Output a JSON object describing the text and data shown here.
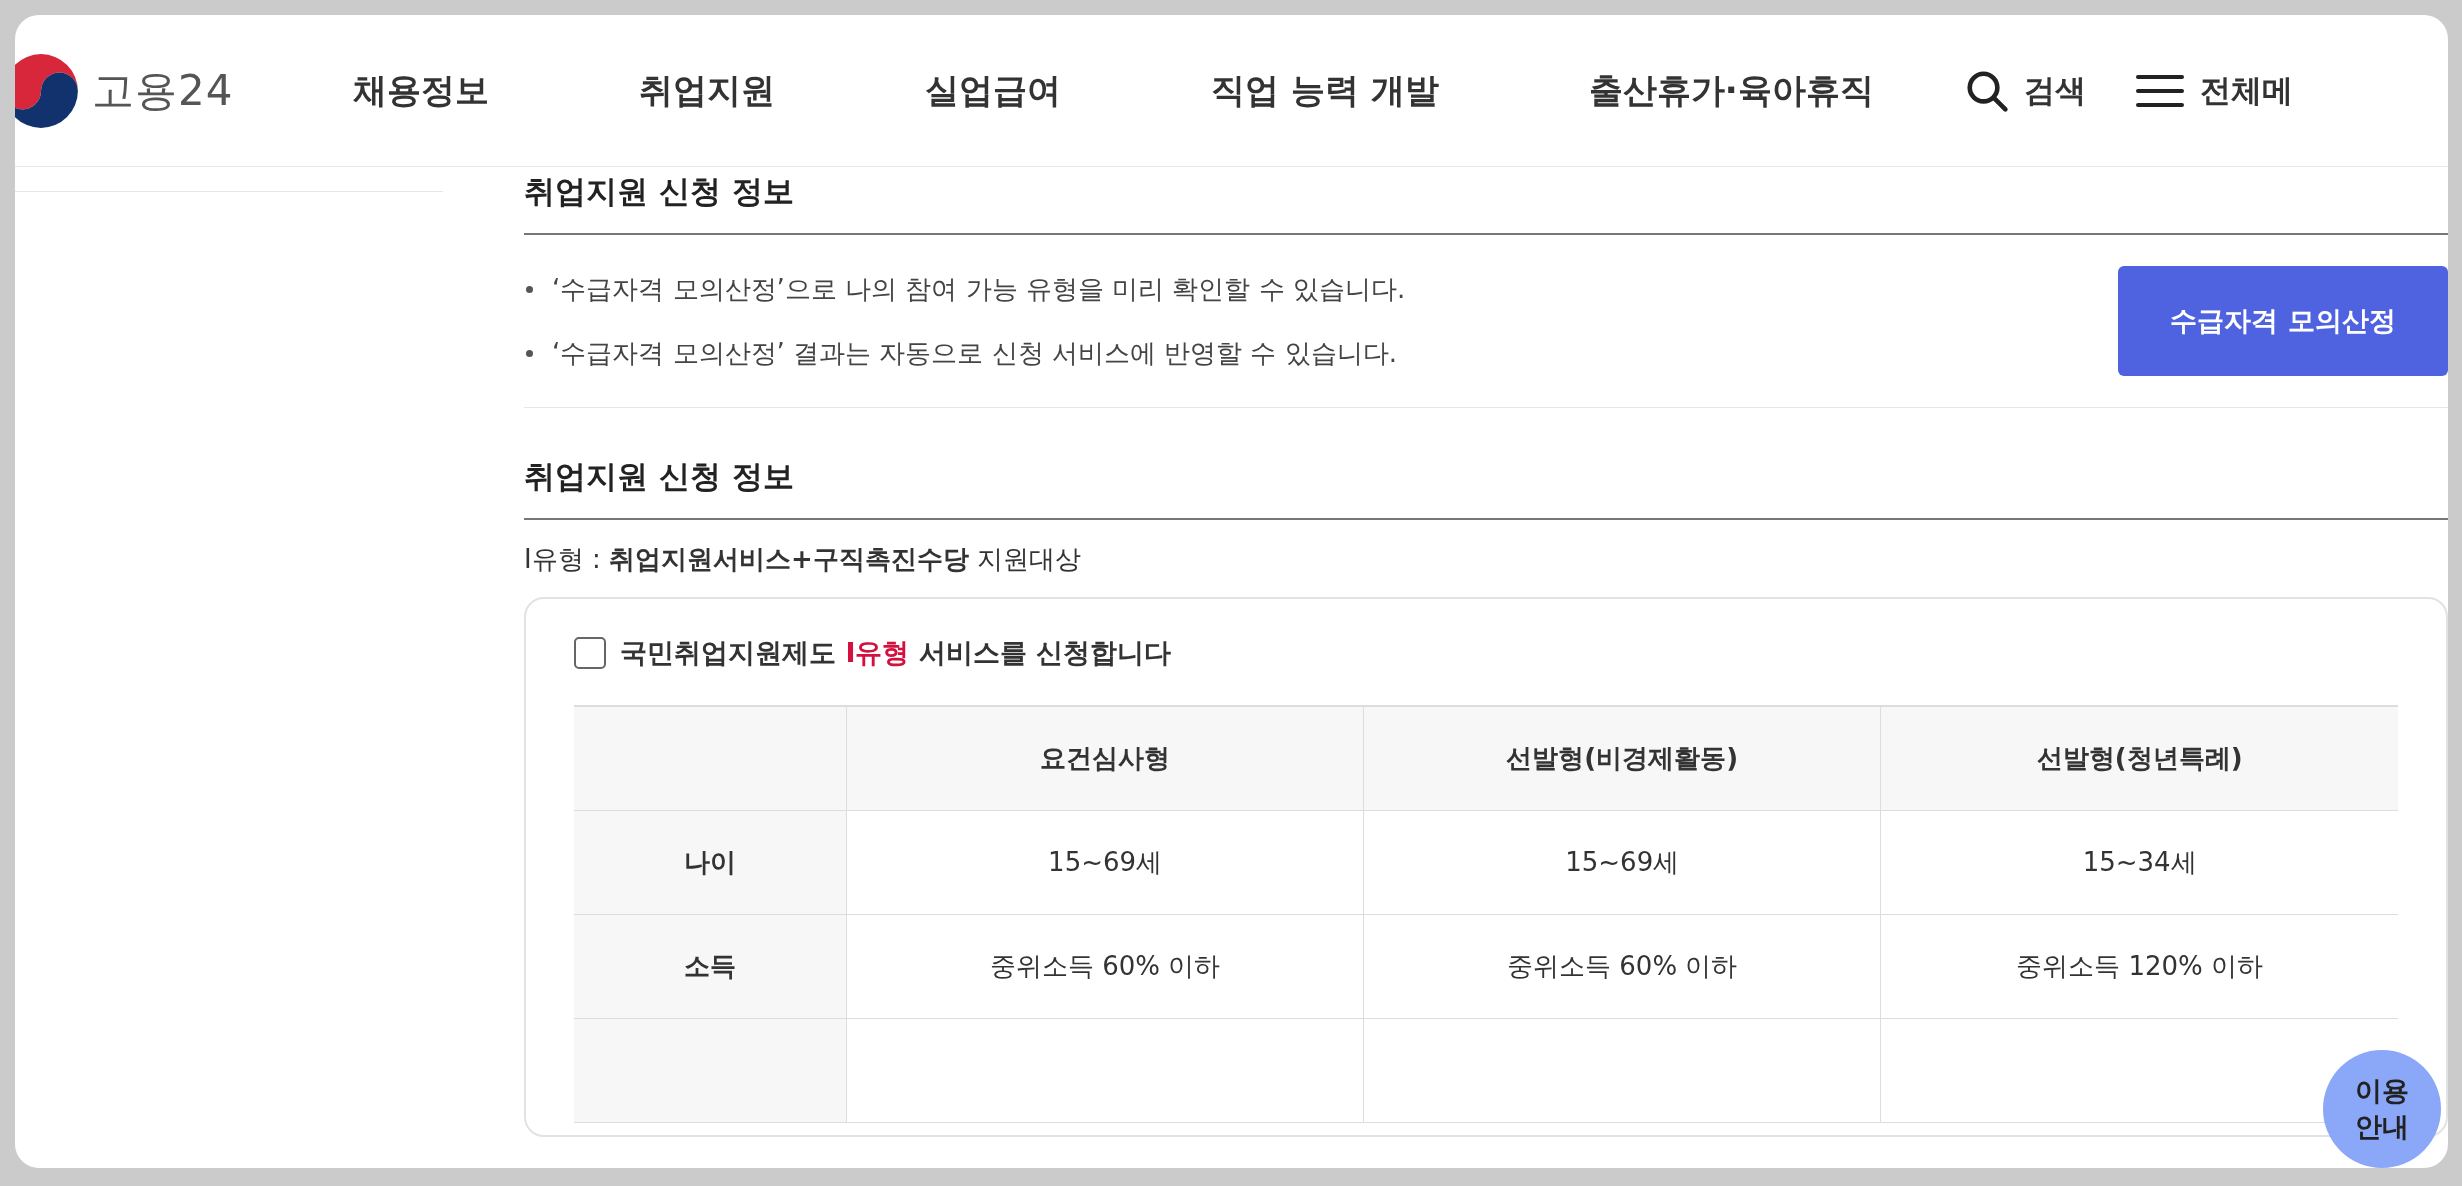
{
  "header": {
    "logo_text": "고용24",
    "nav": [
      "채용정보",
      "취업지원",
      "실업급여",
      "직업 능력 개발",
      "출산휴가·육아휴직"
    ],
    "search_label": "검색",
    "menu_label": "전체메"
  },
  "info_section": {
    "title": "취업지원 신청 정보",
    "notes": [
      "‘수급자격 모의산정’으로 나의 참여 가능 유형을 미리 확인할 수 있습니다.",
      "‘수급자격 모의산정’ 결과는 자동으로 신청 서비스에 반영할 수 있습니다."
    ],
    "button": "수급자격 모의산정"
  },
  "apply_section": {
    "title": "취업지원 신청 정보",
    "type_line": "I유형 : **취업지원서비스+구직촉진수당** 지원대상",
    "apply": {
      "checked": false,
      "text_before": "국민취업지원제도",
      "highlight": "I유형",
      "text_after": "서비스를 신청합니다"
    },
    "table": {
      "columns": [
        "요건심사형",
        "선발형(비경제활동)",
        "선발형(청년특례)"
      ],
      "rows": [
        {
          "label": "나이",
          "cells": [
            "15~69세",
            "15~69세",
            "15~34세"
          ]
        },
        {
          "label": "소득",
          "cells": [
            "중위소득 60% 이하",
            "중위소득 60% 이하",
            "중위소득 120% 이하"
          ]
        }
      ]
    }
  },
  "help_button": "이용 안내"
}
